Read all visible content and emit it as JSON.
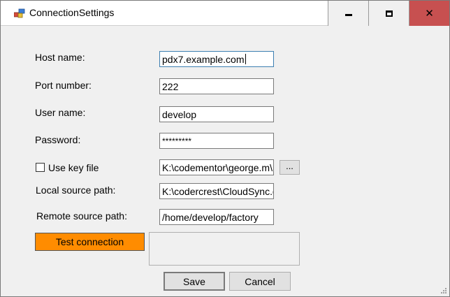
{
  "window": {
    "title": "ConnectionSettings",
    "minimize_label": "minimize",
    "maximize_label": "maximize",
    "close_label": "close"
  },
  "form": {
    "host": {
      "label": "Host name:",
      "value": "pdx7.example.com"
    },
    "port": {
      "label": "Port number:",
      "value": "222"
    },
    "user": {
      "label": "User name:",
      "value": "develop"
    },
    "password": {
      "label": "Password:",
      "value": "*********"
    },
    "key_file": {
      "label": "Use key file",
      "checked": false,
      "value": "K:\\codementor\\george.m\\r",
      "browse_label": "..."
    },
    "local_path": {
      "label": "Local source path:",
      "value": "K:\\codercrest\\CloudSync.g"
    },
    "remote_path": {
      "label": "Remote source path:",
      "value": "/home/develop/factory"
    },
    "test_button": "Test connection",
    "test_result": ""
  },
  "footer": {
    "save_label": "Save",
    "cancel_label": "Cancel"
  },
  "colors": {
    "test_button": "#ff8c00",
    "close_button": "#c75050"
  }
}
